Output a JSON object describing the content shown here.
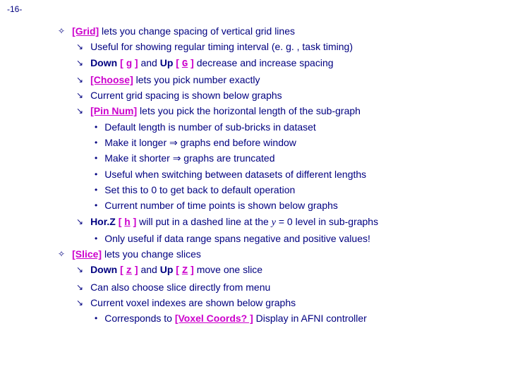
{
  "page_number": "-16-",
  "lines": [
    {
      "level": 1,
      "bullet": "diamond",
      "segments": [
        {
          "t": "[Grid]",
          "c": "btn"
        },
        {
          "t": " lets you change spacing of vertical grid lines"
        }
      ]
    },
    {
      "level": 2,
      "bullet": "arrow",
      "segments": [
        {
          "t": "Useful for showing regular timing interval (e. g. , task timing)"
        }
      ]
    },
    {
      "level": 2,
      "bullet": "arrow",
      "segments": [
        {
          "t": "Down ",
          "c": "bold"
        },
        {
          "t": "[ ",
          "c": "brk"
        },
        {
          "t": "g",
          "c": "key"
        },
        {
          "t": " ]",
          "c": "brk"
        },
        {
          "t": " and "
        },
        {
          "t": "Up ",
          "c": "bold"
        },
        {
          "t": "[ ",
          "c": "brk"
        },
        {
          "t": "G",
          "c": "key"
        },
        {
          "t": " ]",
          "c": "brk"
        },
        {
          "t": " decrease and increase spacing"
        }
      ]
    },
    {
      "level": 2,
      "bullet": "arrow",
      "segments": [
        {
          "t": "[Choose]",
          "c": "btn"
        },
        {
          "t": " lets you pick number exactly"
        }
      ]
    },
    {
      "level": 2,
      "bullet": "arrow",
      "segments": [
        {
          "t": "Current grid spacing is shown below graphs"
        }
      ]
    },
    {
      "level": 2,
      "bullet": "arrow",
      "segments": [
        {
          "t": "[Pin Num]",
          "c": "btn"
        },
        {
          "t": " lets you pick the horizontal length of the sub-graph"
        }
      ]
    },
    {
      "level": 3,
      "bullet": "dot",
      "segments": [
        {
          "t": "Default length is number of sub-bricks in dataset"
        }
      ]
    },
    {
      "level": 3,
      "bullet": "dot",
      "segments": [
        {
          "t": "Make it longer "
        },
        {
          "t": "⇒",
          "c": "arrow"
        },
        {
          "t": " graphs end before window"
        }
      ]
    },
    {
      "level": 3,
      "bullet": "dot",
      "segments": [
        {
          "t": "Make it shorter "
        },
        {
          "t": "⇒",
          "c": "arrow"
        },
        {
          "t": " graphs are truncated"
        }
      ]
    },
    {
      "level": 3,
      "bullet": "dot",
      "segments": [
        {
          "t": "Useful when switching between datasets of different lengths"
        }
      ]
    },
    {
      "level": 3,
      "bullet": "dot",
      "segments": [
        {
          "t": "Set this to 0 to get back to default operation"
        }
      ]
    },
    {
      "level": 3,
      "bullet": "dot",
      "segments": [
        {
          "t": "Current number of time points is shown below graphs"
        }
      ]
    },
    {
      "level": 2,
      "bullet": "arrow",
      "segments": [
        {
          "t": "Hor.Z ",
          "c": "bold"
        },
        {
          "t": "[ ",
          "c": "brk"
        },
        {
          "t": "h",
          "c": "key"
        },
        {
          "t": " ]",
          "c": "brk"
        },
        {
          "t": " will put in a dashed line at the "
        },
        {
          "t": "y",
          "c": "ital"
        },
        {
          "t": " = 0 level in sub-graphs"
        }
      ]
    },
    {
      "level": 3,
      "bullet": "dot",
      "segments": [
        {
          "t": "Only useful if data range spans negative and positive values!"
        }
      ]
    },
    {
      "level": 1,
      "bullet": "diamond",
      "segments": [
        {
          "t": "[Slice]",
          "c": "btn"
        },
        {
          "t": " lets you change slices"
        }
      ]
    },
    {
      "level": 2,
      "bullet": "arrow",
      "segments": [
        {
          "t": "Down ",
          "c": "bold"
        },
        {
          "t": "[ ",
          "c": "brk"
        },
        {
          "t": "z",
          "c": "key"
        },
        {
          "t": " ]",
          "c": "brk"
        },
        {
          "t": " and "
        },
        {
          "t": "Up ",
          "c": "bold"
        },
        {
          "t": "[ ",
          "c": "brk"
        },
        {
          "t": "Z",
          "c": "key"
        },
        {
          "t": " ]",
          "c": "brk"
        },
        {
          "t": " move one slice"
        }
      ]
    },
    {
      "level": 2,
      "bullet": "arrow",
      "segments": [
        {
          "t": "Can also choose slice directly from menu"
        }
      ]
    },
    {
      "level": 2,
      "bullet": "arrow",
      "segments": [
        {
          "t": "Current voxel indexes are shown below graphs"
        }
      ]
    },
    {
      "level": 3,
      "bullet": "dot",
      "segments": [
        {
          "t": "Corresponds to "
        },
        {
          "t": "[Voxel Coords? ]",
          "c": "btn"
        },
        {
          "t": " Display in AFNI controller"
        }
      ]
    }
  ]
}
